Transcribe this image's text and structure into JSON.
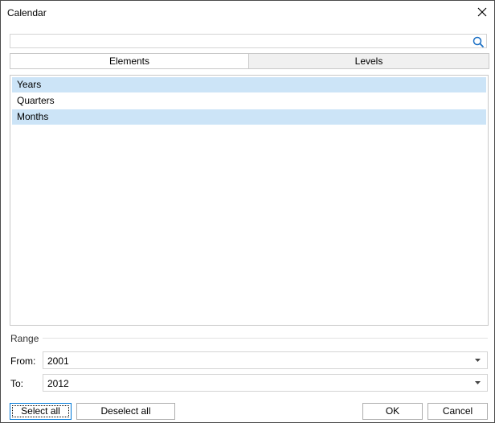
{
  "window": {
    "title": "Calendar"
  },
  "search": {
    "value": "",
    "placeholder": ""
  },
  "tabs": [
    {
      "label": "Elements",
      "active": true
    },
    {
      "label": "Levels",
      "active": false
    }
  ],
  "levels": [
    {
      "label": "Years",
      "selected": true
    },
    {
      "label": "Quarters",
      "selected": false
    },
    {
      "label": "Months",
      "selected": true
    }
  ],
  "range": {
    "label": "Range",
    "from_label": "From:",
    "from_value": "2001",
    "to_label": "To:",
    "to_value": "2012"
  },
  "buttons": {
    "select_all": "Select all",
    "deselect_all": "Deselect all",
    "ok": "OK",
    "cancel": "Cancel"
  },
  "colors": {
    "selection": "#cce4f7",
    "accent": "#0078d7",
    "border": "#c8c8c8"
  }
}
